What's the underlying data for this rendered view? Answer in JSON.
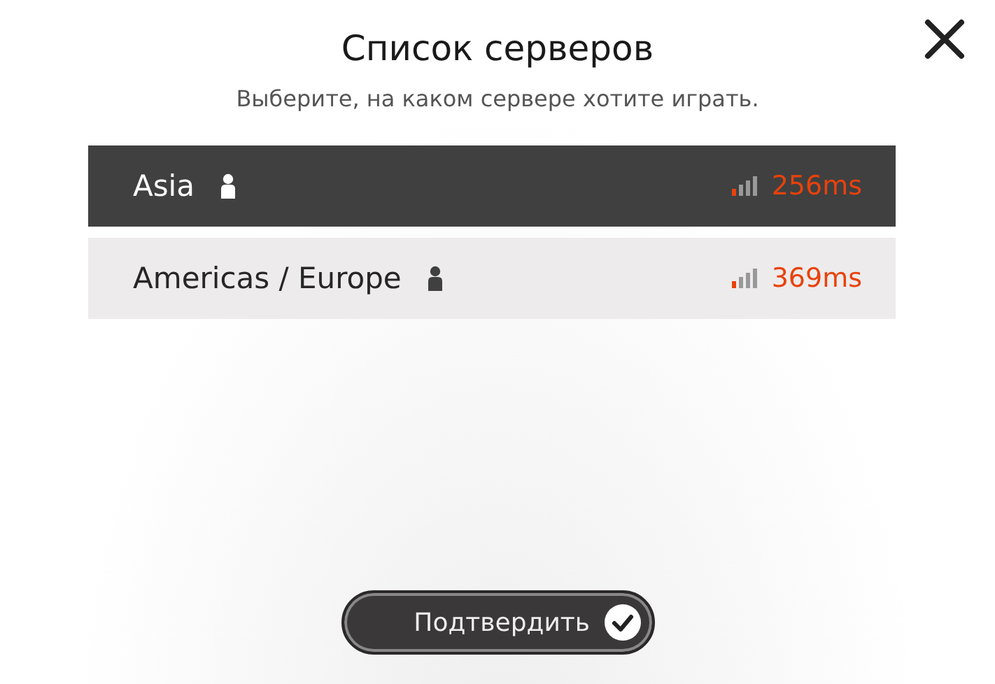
{
  "dialog": {
    "title": "Список серверов",
    "subtitle": "Выберите, на каком сервере хотите играть."
  },
  "servers": [
    {
      "name": "Asia",
      "ping": "256ms",
      "selected": true
    },
    {
      "name": "Americas / Europe",
      "ping": "369ms",
      "selected": false
    }
  ],
  "confirm_button": {
    "label": "Подтвердить"
  }
}
